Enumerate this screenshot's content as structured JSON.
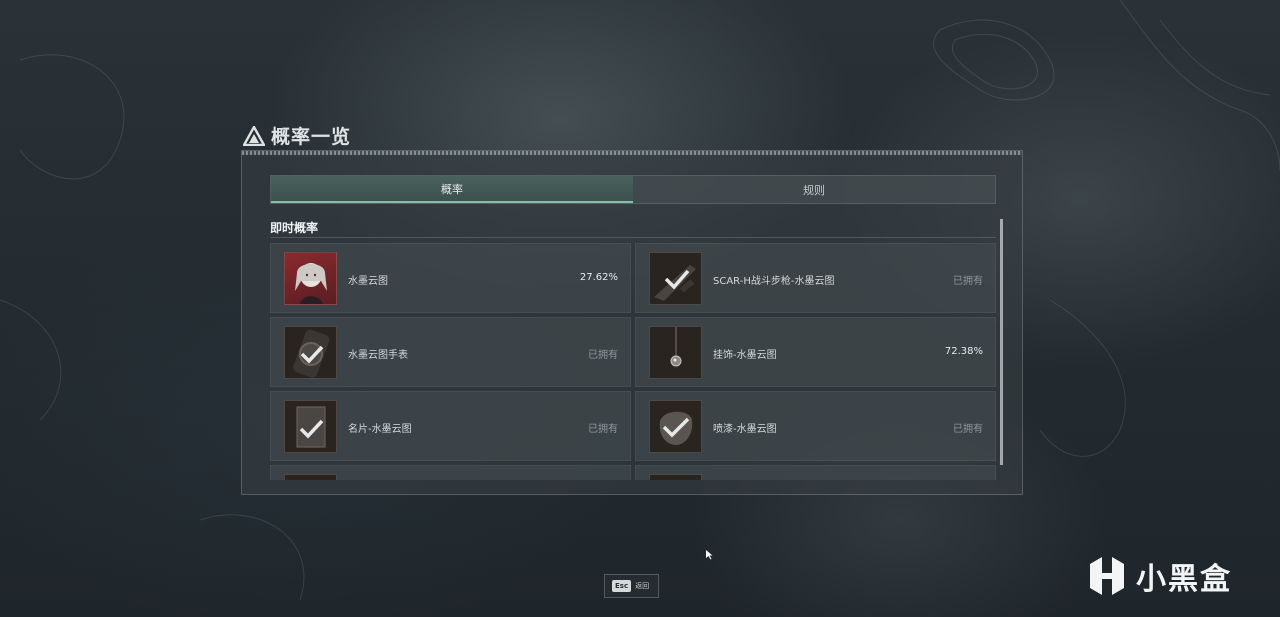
{
  "panel": {
    "title": "概率一览",
    "tabs": [
      {
        "label": "概率",
        "active": true
      },
      {
        "label": "规则",
        "active": false
      }
    ],
    "section_title": "即时概率",
    "items": [
      {
        "name": "水墨云图",
        "value": "27.62%",
        "owned": false,
        "icon": "character-portrait-icon"
      },
      {
        "name": "SCAR-H战斗步枪-水墨云图",
        "value": "已拥有",
        "owned": true,
        "icon": "rifle-check-icon"
      },
      {
        "name": "水墨云图手表",
        "value": "已拥有",
        "owned": true,
        "icon": "watch-check-icon"
      },
      {
        "name": "挂饰-水墨云图",
        "value": "72.38%",
        "owned": false,
        "icon": "charm-icon"
      },
      {
        "name": "名片-水墨云图",
        "value": "已拥有",
        "owned": true,
        "icon": "card-check-icon"
      },
      {
        "name": "喷漆-水墨云图",
        "value": "已拥有",
        "owned": true,
        "icon": "spray-check-icon"
      }
    ]
  },
  "footer": {
    "esc_key": "Esc",
    "esc_label": "返回"
  },
  "watermark": {
    "text": "小黑盒"
  },
  "colors": {
    "accent_tab": "#7fc2a8",
    "panel_bg": "#373e42"
  }
}
